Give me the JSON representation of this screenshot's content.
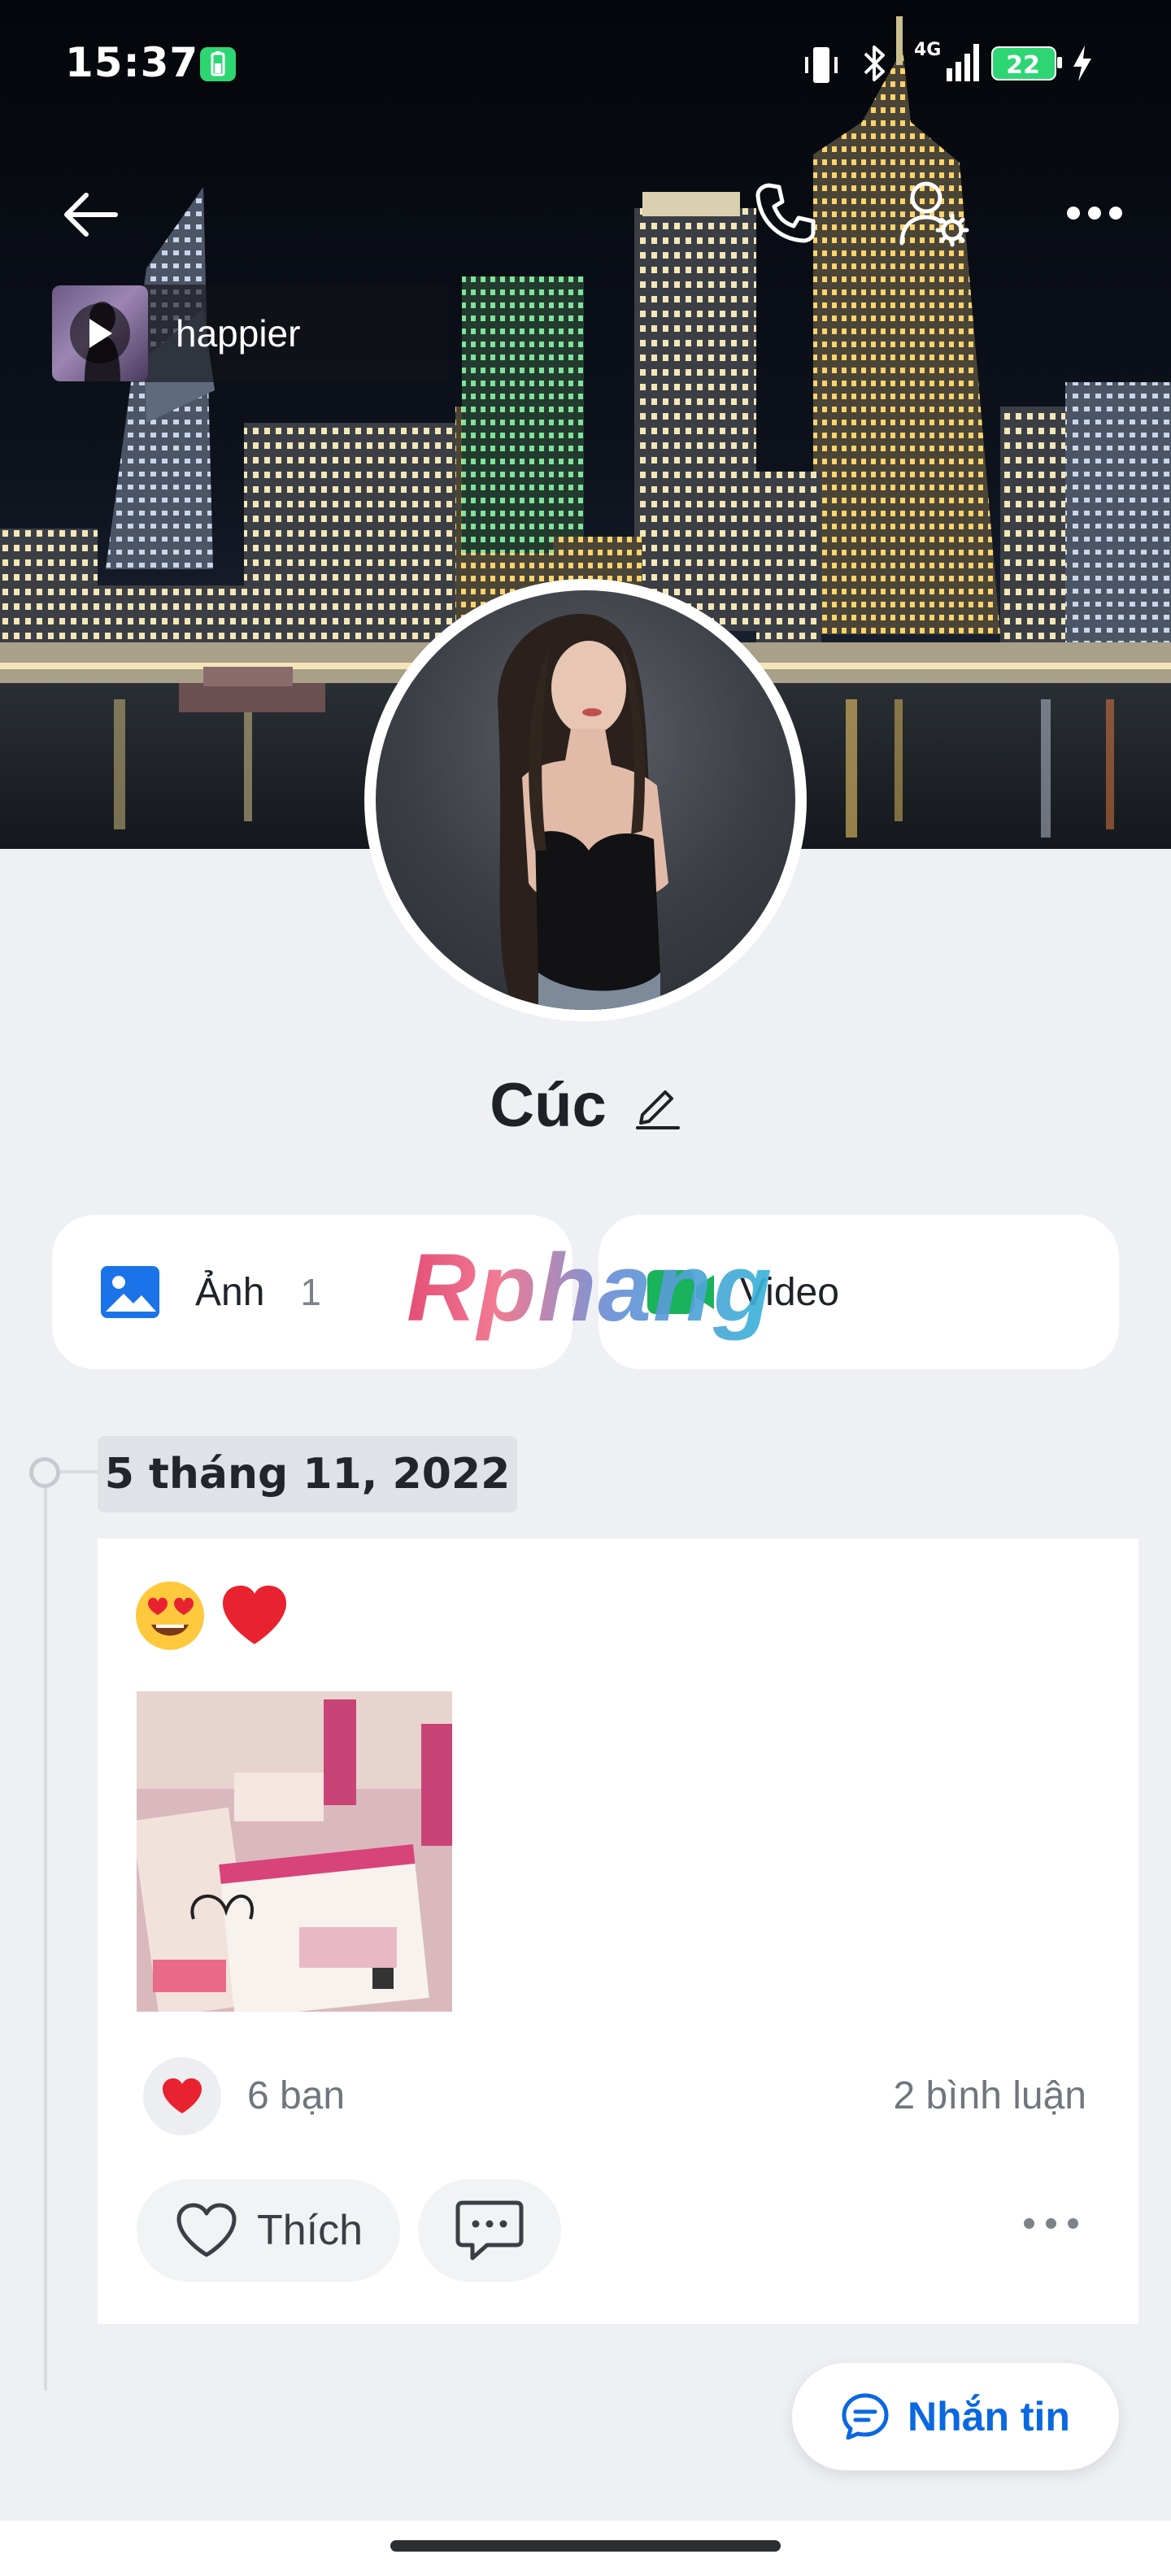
{
  "status_bar": {
    "time": "15:37",
    "network": "4G",
    "battery": "22",
    "icons": [
      "battery-saver-icon",
      "vibrate-icon",
      "bluetooth-icon",
      "signal-icon",
      "battery-icon",
      "charging-icon"
    ]
  },
  "topbar": {
    "icons": [
      "back-arrow-icon",
      "phone-icon",
      "user-settings-icon",
      "more-icon"
    ]
  },
  "music": {
    "title": "happier",
    "icon": "play-icon"
  },
  "profile": {
    "name": "Cúc",
    "edit_icon": "pencil-icon"
  },
  "media": {
    "photos_label": "Ảnh",
    "photos_count": "1",
    "video_label": "Video"
  },
  "watermark": "Rphang",
  "timeline": {
    "date": "5 tháng 11, 2022"
  },
  "post": {
    "reaction_count": "6 bạn",
    "comment_count": "2 bình luận",
    "like_label": "Thích",
    "icons": [
      "heart-eyes-emoji",
      "red-heart-emoji",
      "heart-reaction-icon",
      "heart-outline-icon",
      "comment-icon",
      "more-icon"
    ]
  },
  "message_button": {
    "label": "Nhắn tin",
    "icon": "chat-icon"
  },
  "colors": {
    "accent": "#0a68e0",
    "photo_icon": "#1a73e8",
    "video_icon": "#18b35a",
    "heart": "#e8232f",
    "background": "#eef0f4"
  }
}
